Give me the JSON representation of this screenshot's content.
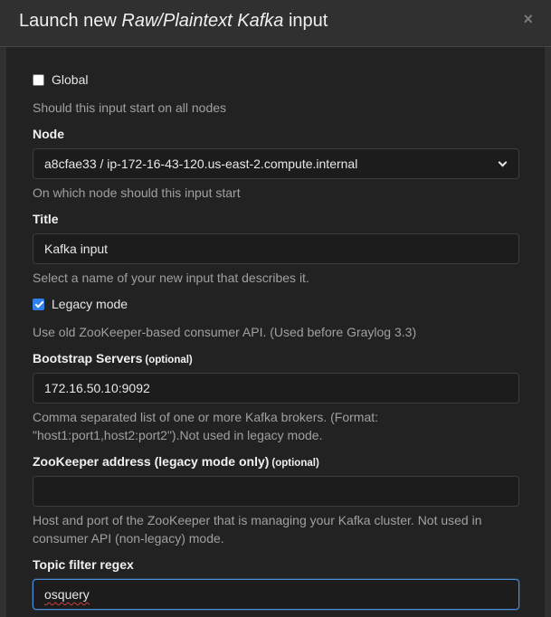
{
  "modal": {
    "title_prefix": "Launch new ",
    "title_type": "Raw/Plaintext Kafka",
    "title_suffix": " input",
    "close_glyph": "×"
  },
  "form": {
    "global": {
      "label": "Global",
      "checked": false,
      "help": "Should this input start on all nodes"
    },
    "node": {
      "label": "Node",
      "selected": "a8cfae33 / ip-172-16-43-120.us-east-2.compute.internal",
      "help": "On which node should this input start"
    },
    "title": {
      "label": "Title",
      "value": "Kafka input",
      "help": "Select a name of your new input that describes it."
    },
    "legacy_mode": {
      "label": "Legacy mode",
      "checked": true,
      "help": "Use old ZooKeeper-based consumer API. (Used before Graylog 3.3)"
    },
    "bootstrap_servers": {
      "label": "Bootstrap Servers",
      "optional": "(optional)",
      "value": "172.16.50.10:9092",
      "help": "Comma separated list of one or more Kafka brokers. (Format: \"host1:port1,host2:port2\").Not used in legacy mode."
    },
    "zookeeper_address": {
      "label": "ZooKeeper address (legacy mode only)",
      "optional": "(optional)",
      "value": "",
      "help": "Host and port of the ZooKeeper that is managing your Kafka cluster. Not used in consumer API (non-legacy) mode."
    },
    "topic_filter": {
      "label": "Topic filter regex",
      "value": "osquery"
    }
  },
  "colors": {
    "modal_bg": "#303030",
    "body_bg": "#222222",
    "checkbox_accent": "#2f80ed",
    "focus_border": "#4a8fdc"
  },
  "icons": {
    "close": "close-icon",
    "select_arrow": "chevron-down-icon"
  }
}
